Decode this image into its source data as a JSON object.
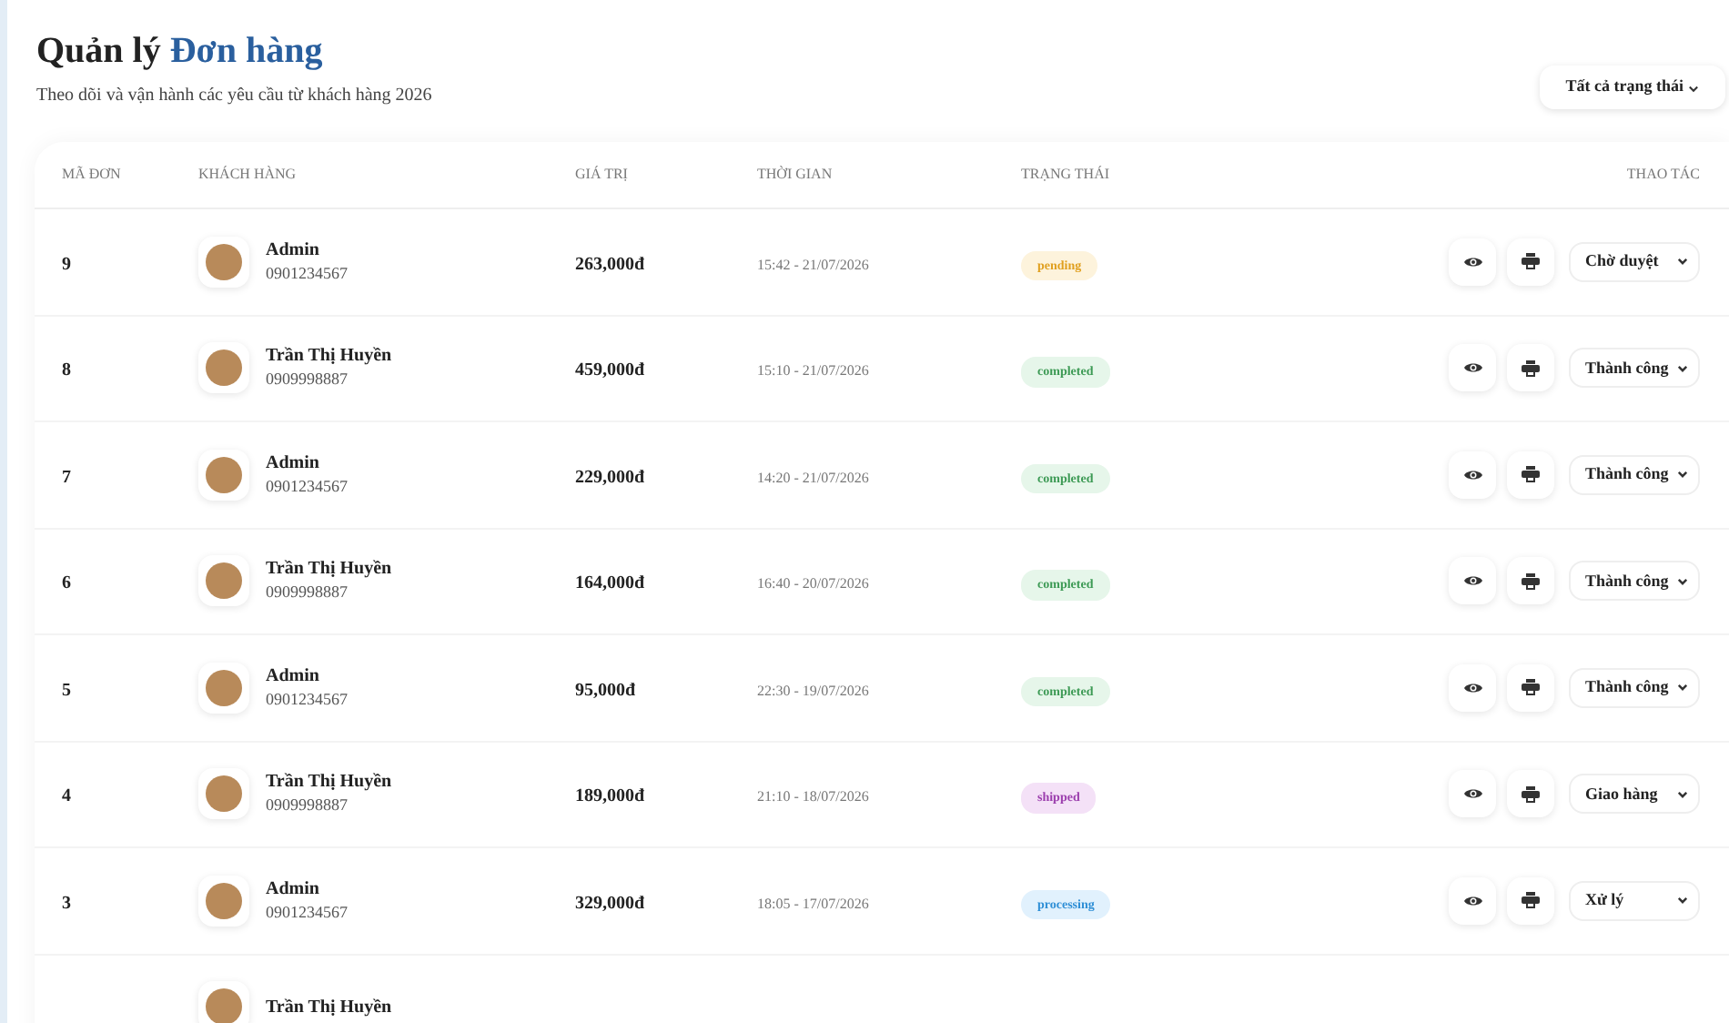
{
  "header": {
    "title": "Quản lý",
    "title_highlight": "Đơn hàng",
    "subtitle": "Theo dõi và vận hành các yêu cầu từ khách hàng 2026",
    "filter": {
      "value": "Tất cả trạng thái"
    }
  },
  "table": {
    "columns": [
      "MÃ ĐƠN",
      "KHÁCH HÀNG",
      "GIÁ TRỊ",
      "THỜI GIAN",
      "TRẠNG THÁI",
      "THAO TÁC"
    ],
    "rows": [
      {
        "id": "9",
        "name": "Admin",
        "phone": "0901234567",
        "price": "263,000đ",
        "time": "15:42 - 21/07/2026",
        "status": {
          "kind": "pending",
          "label": "pending"
        },
        "action": "Chờ duyệt"
      },
      {
        "id": "8",
        "name": "Trần Thị Huyền",
        "phone": "0909998887",
        "price": "459,000đ",
        "time": "15:10 - 21/07/2026",
        "status": {
          "kind": "completed",
          "label": "completed"
        },
        "action": "Thành công"
      },
      {
        "id": "7",
        "name": "Admin",
        "phone": "0901234567",
        "price": "229,000đ",
        "time": "14:20 - 21/07/2026",
        "status": {
          "kind": "completed",
          "label": "completed"
        },
        "action": "Thành công"
      },
      {
        "id": "6",
        "name": "Trần Thị Huyền",
        "phone": "0909998887",
        "price": "164,000đ",
        "time": "16:40 - 20/07/2026",
        "status": {
          "kind": "completed",
          "label": "completed"
        },
        "action": "Thành công"
      },
      {
        "id": "5",
        "name": "Admin",
        "phone": "0901234567",
        "price": "95,000đ",
        "time": "22:30 - 19/07/2026",
        "status": {
          "kind": "completed",
          "label": "completed"
        },
        "action": "Thành công"
      },
      {
        "id": "4",
        "name": "Trần Thị Huyền",
        "phone": "0909998887",
        "price": "189,000đ",
        "time": "21:10 - 18/07/2026",
        "status": {
          "kind": "shipped",
          "label": "shipped"
        },
        "action": "Giao hàng"
      },
      {
        "id": "3",
        "name": "Admin",
        "phone": "0901234567",
        "price": "329,000đ",
        "time": "18:05 - 17/07/2026",
        "status": {
          "kind": "processing",
          "label": "processing"
        },
        "action": "Xử lý"
      },
      {
        "name": "Trần Thị Huyền"
      }
    ]
  }
}
